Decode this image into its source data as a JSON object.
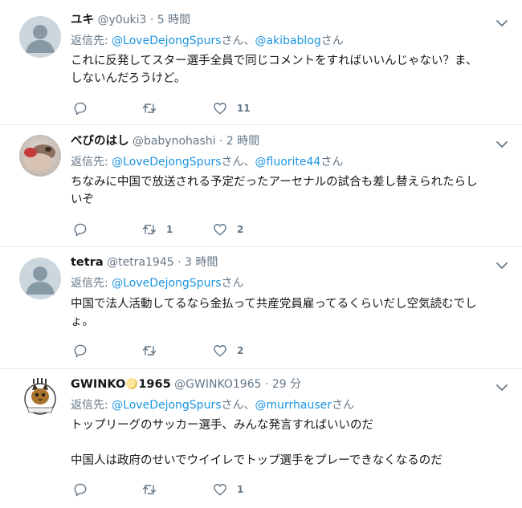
{
  "ui": {
    "reply_prefix": "返信先:",
    "separator": "・",
    "dot": "·"
  },
  "tweets": [
    {
      "name": "ユキ",
      "handle": "@y0uki3",
      "time": "5 時間",
      "mentions": [
        "@LoveDejongSpurs",
        "@akibablog"
      ],
      "suffix1": "さん、",
      "suffix2": "さん",
      "lines": [
        "これに反発してスター選手全員で同じコメントをすればいいんじゃない？ま、",
        "しないんだろうけど。"
      ],
      "reply_count": "",
      "retweet_count": "",
      "like_count": "11"
    },
    {
      "name": "べびのはし",
      "handle": "@babynohashi",
      "time": "2 時間",
      "mentions": [
        "@LoveDejongSpurs",
        "@fluorite44"
      ],
      "suffix1": "さん、",
      "suffix2": "さん",
      "lines": [
        "ちなみに中国で放送される予定だったアーセナルの試合も差し替えられたらし",
        "いぞ"
      ],
      "reply_count": "",
      "retweet_count": "1",
      "like_count": "2"
    },
    {
      "name": "tetra",
      "handle": "@tetra1945",
      "time": "3 時間",
      "mentions": [
        "@LoveDejongSpurs"
      ],
      "suffix1": "さん",
      "lines": [
        "中国で法人活動してるなら金払って共産党員雇ってるくらいだし空気読むでし",
        "ょ。"
      ],
      "reply_count": "",
      "retweet_count": "",
      "like_count": "2"
    },
    {
      "name": "GWINKO",
      "name_suffix": "1965",
      "handle": "@GWINKO1965",
      "time": "29 分",
      "mentions": [
        "@LoveDejongSpurs",
        "@murrhauser"
      ],
      "suffix1": "さん、",
      "suffix2": "さん",
      "lines": [
        "トップリーグのサッカー選手、みんな発言すればいいのだ",
        "",
        "中国人は政府のせいでウイイレでトップ選手をプレーできなくなるのだ"
      ],
      "reply_count": "",
      "retweet_count": "",
      "like_count": "1",
      "avatar_text": "GWINKO THE CAT"
    }
  ],
  "icons": {
    "reply": "reply-icon",
    "retweet": "retweet-icon",
    "like": "heart-icon",
    "caret": "chevron-down-icon"
  },
  "colors": {
    "mention": "#1b95e0",
    "secondary": "#657786",
    "divider": "#e6ecf0",
    "text": "#14171a"
  }
}
